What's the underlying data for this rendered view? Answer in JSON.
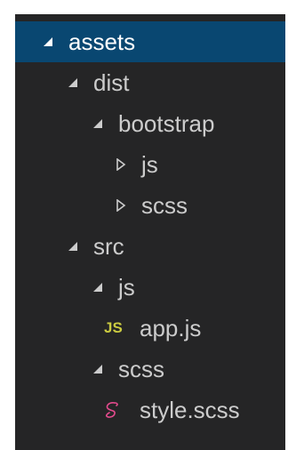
{
  "explorer": {
    "items": [
      {
        "label": "assets",
        "kind": "folder",
        "expanded": true,
        "selected": true,
        "depth": 0
      },
      {
        "label": "dist",
        "kind": "folder",
        "expanded": true,
        "depth": 1
      },
      {
        "label": "bootstrap",
        "kind": "folder",
        "expanded": true,
        "depth": 2
      },
      {
        "label": "js",
        "kind": "folder",
        "expanded": false,
        "depth": 3
      },
      {
        "label": "scss",
        "kind": "folder",
        "expanded": false,
        "depth": 3
      },
      {
        "label": "src",
        "kind": "folder",
        "expanded": true,
        "depth": 1
      },
      {
        "label": "js",
        "kind": "folder",
        "expanded": true,
        "depth": 2
      },
      {
        "label": "app.js",
        "kind": "file",
        "icon": "js-file-icon",
        "icon_text": "JS",
        "depth": 3
      },
      {
        "label": "scss",
        "kind": "folder",
        "expanded": true,
        "depth": 2
      },
      {
        "label": "style.scss",
        "kind": "file",
        "icon": "sass-file-icon",
        "depth": 3
      }
    ]
  },
  "colors": {
    "background": "#252526",
    "selection": "#094771",
    "text": "#cccccc",
    "selected_text": "#ffffff",
    "js_icon": "#cbcb41",
    "sass_icon": "#e44b8d"
  }
}
